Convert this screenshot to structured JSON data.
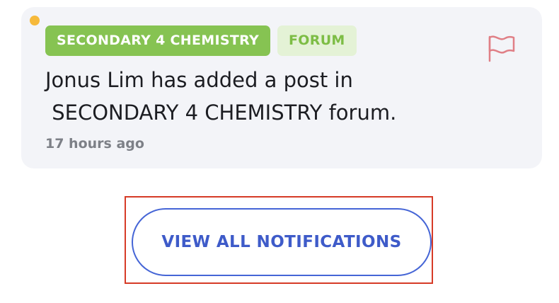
{
  "notification": {
    "course_tag": "SECONDARY 4 CHEMISTRY",
    "type_tag": "FORUM",
    "message": "Jonus Lim has added a post in\n SECONDARY 4 CHEMISTRY forum.",
    "time": "17 hours ago",
    "unread": true,
    "flag_icon": "flag-icon"
  },
  "actions": {
    "view_all_label": "VIEW ALL NOTIFICATIONS"
  },
  "colors": {
    "unread_dot": "#f6b93b",
    "course_tag_bg": "#86c352",
    "type_tag_bg": "#e4f2d6",
    "flag": "#e07f86",
    "button_accent": "#4565d6",
    "highlight": "#d63b27"
  }
}
